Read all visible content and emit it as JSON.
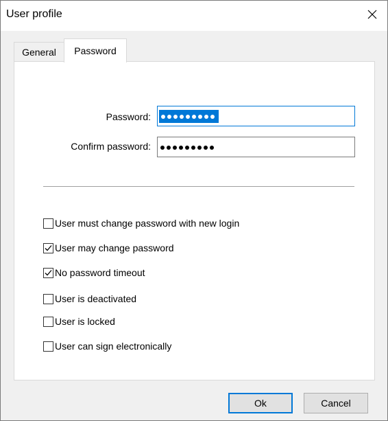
{
  "window": {
    "title": "User profile",
    "close_icon": "close-icon"
  },
  "tabs": [
    {
      "label": "General",
      "active": false
    },
    {
      "label": "Password",
      "active": true
    }
  ],
  "password": {
    "label": "Password:",
    "masked_length": 9,
    "focused": true,
    "selected": true
  },
  "confirm_password": {
    "label": "Confirm password:",
    "masked_length": 9
  },
  "options": [
    {
      "label": "User must change password with new login",
      "checked": false
    },
    {
      "label": "User may change password",
      "checked": true
    },
    {
      "label": "No password timeout",
      "checked": true
    },
    {
      "label": "User is deactivated",
      "checked": false
    },
    {
      "label": "User is locked",
      "checked": false
    },
    {
      "label": "User can sign electronically",
      "checked": false
    }
  ],
  "buttons": {
    "ok": "Ok",
    "cancel": "Cancel"
  },
  "colors": {
    "accent": "#0078d7",
    "panel": "#ffffff",
    "dialog_bg": "#f0f0f0"
  }
}
